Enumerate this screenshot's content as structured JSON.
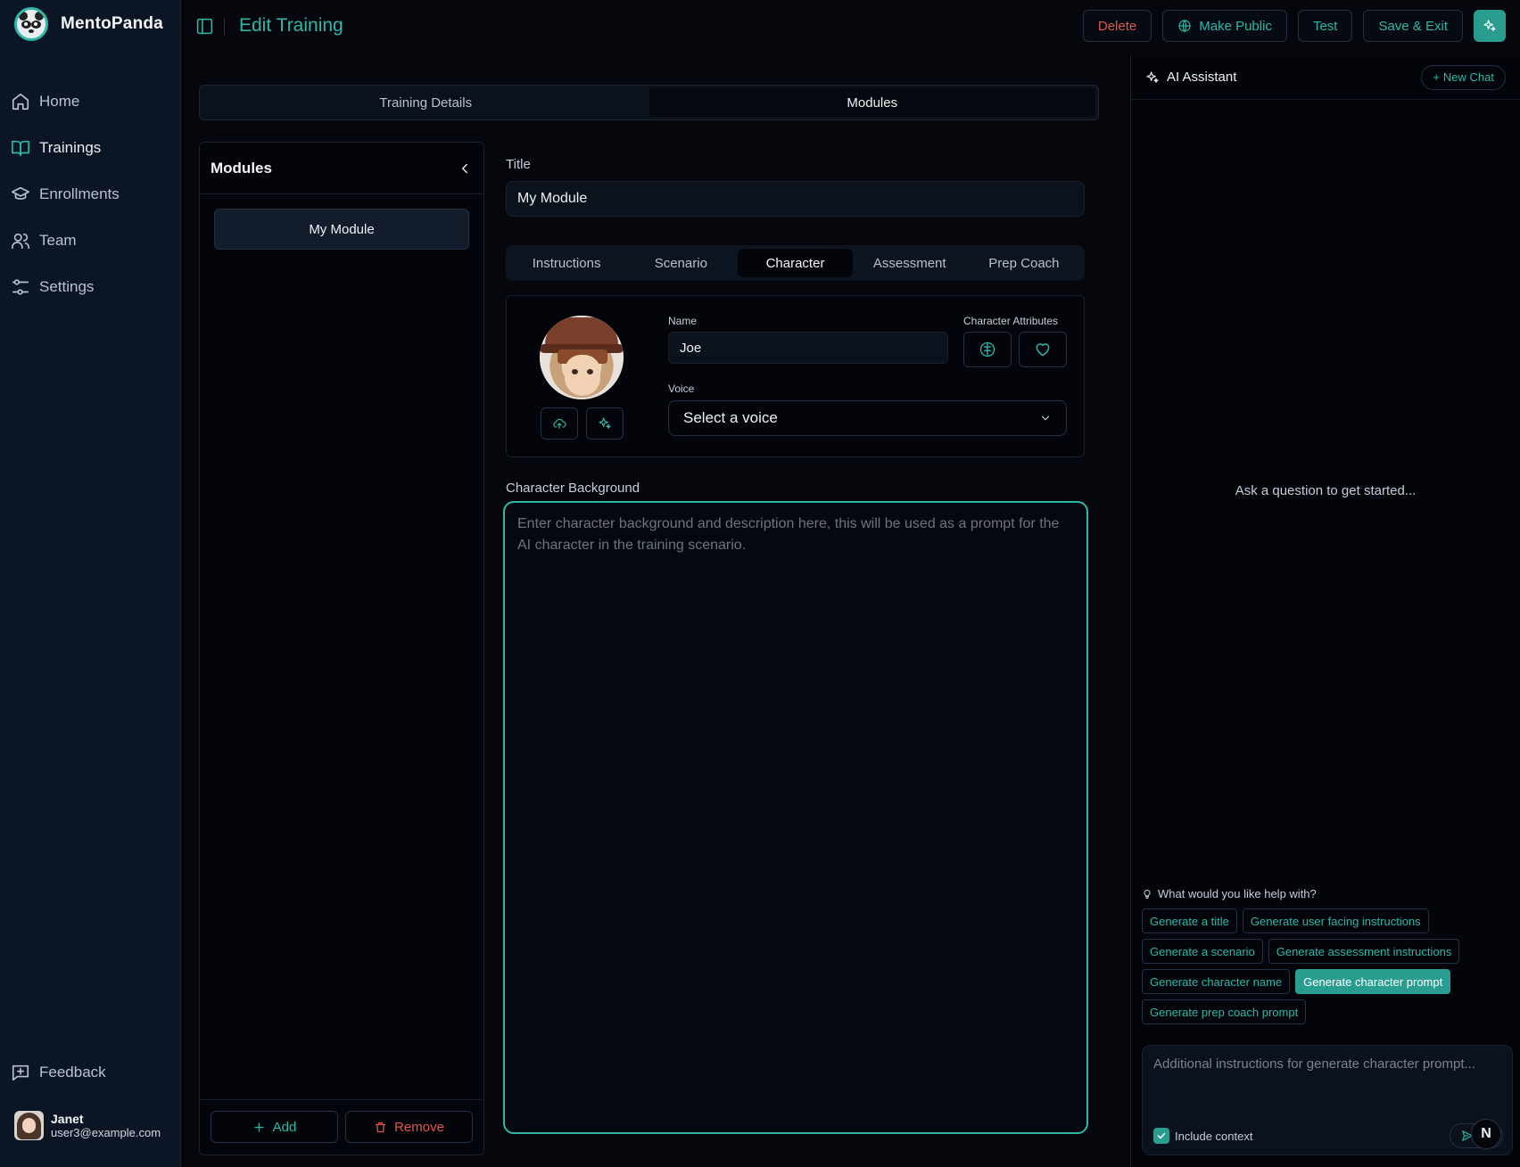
{
  "brand": {
    "name": "MentoPanda"
  },
  "sidebar": {
    "items": [
      {
        "label": "Home",
        "icon": "home-icon"
      },
      {
        "label": "Trainings",
        "icon": "book-icon",
        "active": true
      },
      {
        "label": "Enrollments",
        "icon": "graduation-cap-icon"
      },
      {
        "label": "Team",
        "icon": "users-icon"
      },
      {
        "label": "Settings",
        "icon": "sliders-icon"
      }
    ],
    "feedback_label": "Feedback",
    "user": {
      "name": "Janet",
      "email": "user3@example.com"
    }
  },
  "header": {
    "title": "Edit Training",
    "actions": {
      "delete": "Delete",
      "make_public": "Make Public",
      "test": "Test",
      "save_exit": "Save & Exit"
    }
  },
  "main_tabs": [
    {
      "label": "Training Details"
    },
    {
      "label": "Modules",
      "active": true
    }
  ],
  "modules": {
    "title": "Modules",
    "items": [
      {
        "label": "My Module",
        "selected": true
      }
    ],
    "add_label": "Add",
    "remove_label": "Remove"
  },
  "editor": {
    "title_label": "Title",
    "title_value": "My Module",
    "tabs": [
      {
        "label": "Instructions"
      },
      {
        "label": "Scenario"
      },
      {
        "label": "Character",
        "active": true
      },
      {
        "label": "Assessment"
      },
      {
        "label": "Prep Coach"
      }
    ],
    "character": {
      "name_label": "Name",
      "name_value": "Joe",
      "attributes_label": "Character Attributes",
      "voice_label": "Voice",
      "voice_value": "Select a voice"
    },
    "background_label": "Character Background",
    "background_placeholder": "Enter character background and description here, this will be used as a prompt for the AI character in the training scenario.",
    "background_value": ""
  },
  "ai_assistant": {
    "title": "AI Assistant",
    "new_chat_label": "New Chat",
    "empty_text": "Ask a question to get started...",
    "help_title": "What would you like help with?",
    "chips": [
      [
        "Generate a title",
        "Generate user facing instructions"
      ],
      [
        "Generate a scenario",
        "Generate assessment instructions"
      ],
      [
        "Generate character name",
        "Generate character prompt"
      ],
      [
        "Generate prep coach prompt"
      ]
    ],
    "active_chip": "Generate character prompt",
    "composer_placeholder": "Additional instructions for generate character prompt...",
    "include_context_label": "Include context",
    "include_context_checked": true
  },
  "floating_badge": "N",
  "colors": {
    "accent": "#2fb7a7",
    "danger": "#e2564f",
    "background": "#05070d",
    "sidebar": "#0c1524"
  }
}
